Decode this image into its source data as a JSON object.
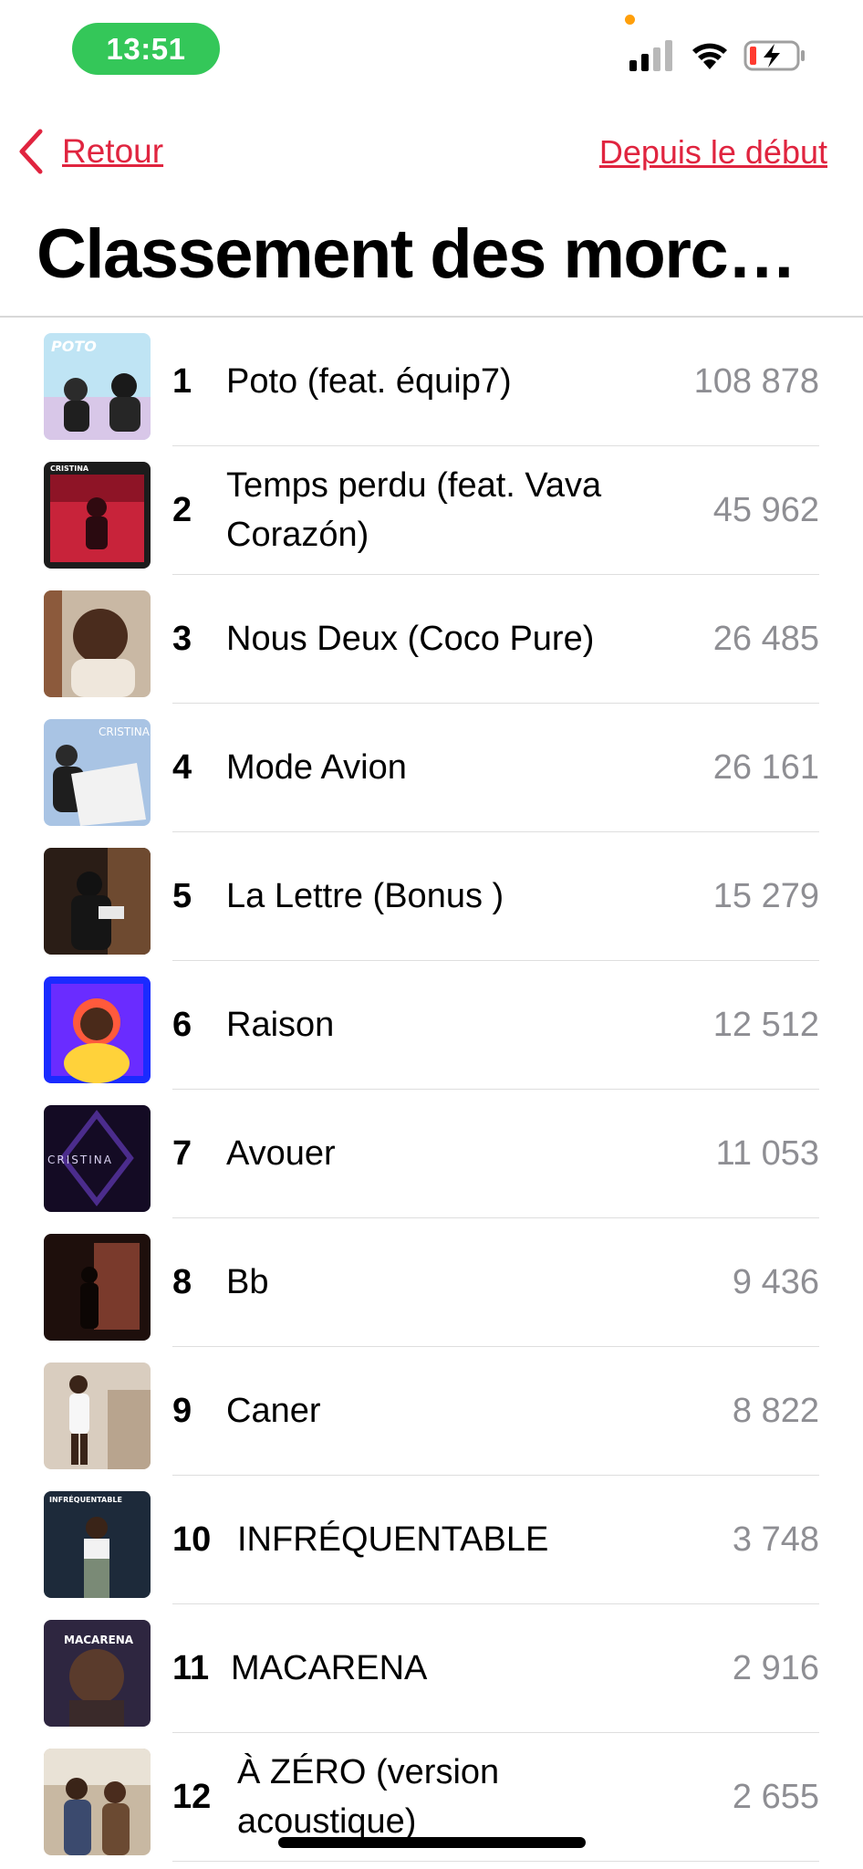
{
  "status_bar": {
    "time": "13:51"
  },
  "nav": {
    "back_label": "Retour",
    "range_label": "Depuis le début"
  },
  "page_title": "Classement des morceaux",
  "tracks": [
    {
      "rank": "1",
      "title": "Poto (feat. équip7)",
      "plays": "108 878"
    },
    {
      "rank": "2",
      "title": "Temps perdu (feat. Vava Corazón)",
      "plays": "45 962"
    },
    {
      "rank": "3",
      "title": "Nous Deux (Coco Pure)",
      "plays": "26 485"
    },
    {
      "rank": "4",
      "title": "Mode Avion",
      "plays": "26 161"
    },
    {
      "rank": "5",
      "title": "La Lettre (Bonus )",
      "plays": "15 279"
    },
    {
      "rank": "6",
      "title": "Raison",
      "plays": "12 512"
    },
    {
      "rank": "7",
      "title": "Avouer",
      "plays": "11 053"
    },
    {
      "rank": "8",
      "title": "Bb",
      "plays": "9 436"
    },
    {
      "rank": "9",
      "title": "Caner",
      "plays": "8 822"
    },
    {
      "rank": "10",
      "title": "INFRÉQUENTABLE",
      "plays": "3 748"
    },
    {
      "rank": "11",
      "title": "MACARENA",
      "plays": "2 916"
    },
    {
      "rank": "12",
      "title": "À ZÉRO (version acoustique)",
      "plays": "2 655"
    }
  ],
  "cover_texts": {
    "t1": "POTO",
    "t2": "CRISTINA",
    "t4": "CRISTINA",
    "t7": "CRISTINA",
    "t10": "INFRÉQUENTABLE",
    "t11": "MACARENA"
  },
  "colors": {
    "accent": "#e0243f",
    "time_pill": "#34c759",
    "secondary_text": "#8e8e93"
  }
}
